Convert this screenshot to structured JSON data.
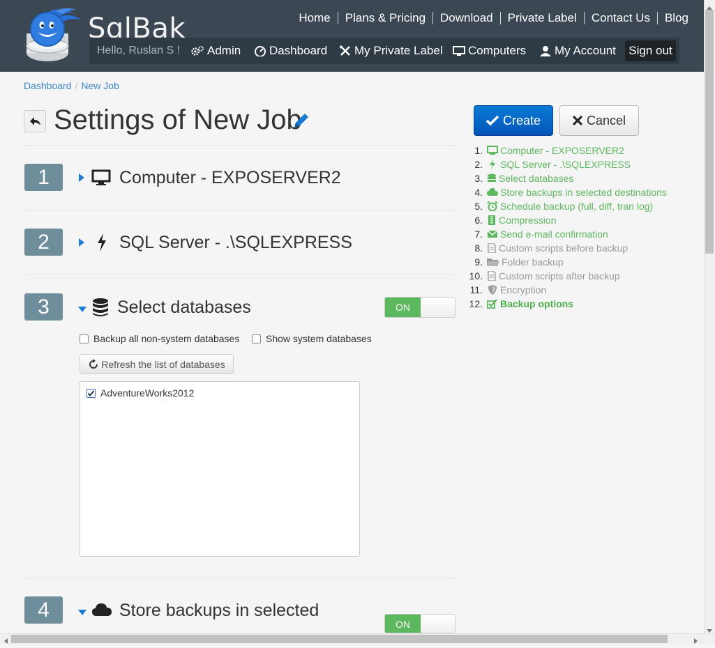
{
  "brand": {
    "logo_text": "SqlBak"
  },
  "top_nav": [
    "Home",
    "Plans & Pricing",
    "Download",
    "Private Label",
    "Contact Us",
    "Blog"
  ],
  "sub_nav": {
    "greeting": "Hello, Ruslan S !",
    "admin": "Admin",
    "dashboard": "Dashboard",
    "private_label": "My Private Label",
    "computers": "Computers",
    "account": "My Account",
    "signout": "Sign out"
  },
  "breadcrumb": {
    "dashboard": "Dashboard",
    "sep": "/",
    "current": "New Job"
  },
  "title": "Settings of New Job",
  "steps": [
    {
      "num": "1",
      "title": "Computer - EXPOSERVER2"
    },
    {
      "num": "2",
      "title": "SQL Server - .\\SQLEXPRESS"
    },
    {
      "num": "3",
      "title": "Select databases",
      "toggle": "ON"
    },
    {
      "num": "4",
      "title": "Store backups in selected",
      "toggle": "ON"
    }
  ],
  "select_db": {
    "backup_all_label": "Backup all non-system databases",
    "show_system_label": "Show system databases",
    "refresh_label": "Refresh the list of databases",
    "databases": [
      {
        "name": "AdventureWorks2012",
        "checked": true
      }
    ]
  },
  "actions": {
    "create": "Create",
    "cancel": "Cancel"
  },
  "step_list": [
    {
      "num": "1.",
      "label": "Computer - EXPOSERVER2",
      "icon": "monitor-icon",
      "state": "done"
    },
    {
      "num": "2.",
      "label": "SQL Server - .\\SQLEXPRESS",
      "icon": "bolt-icon",
      "state": "done"
    },
    {
      "num": "3.",
      "label": "Select databases",
      "icon": "database-icon",
      "state": "done"
    },
    {
      "num": "4.",
      "label": "Store backups in selected destinations",
      "icon": "cloud-icon",
      "state": "done"
    },
    {
      "num": "5.",
      "label": "Schedule backup (full, diff, tran log)",
      "icon": "alarm-clock-icon",
      "state": "done"
    },
    {
      "num": "6.",
      "label": "Compression",
      "icon": "compress-icon",
      "state": "done"
    },
    {
      "num": "7.",
      "label": "Send e-mail confirmation",
      "icon": "envelope-icon",
      "state": "done"
    },
    {
      "num": "8.",
      "label": "Custom scripts before backup",
      "icon": "file-icon",
      "state": "todo"
    },
    {
      "num": "9.",
      "label": "Folder backup",
      "icon": "folder-icon",
      "state": "todo"
    },
    {
      "num": "10.",
      "label": "Custom scripts after backup",
      "icon": "file-icon",
      "state": "todo"
    },
    {
      "num": "11.",
      "label": "Encryption",
      "icon": "shield-icon",
      "state": "todo"
    },
    {
      "num": "12.",
      "label": "Backup options",
      "icon": "check-square-icon",
      "state": "current"
    }
  ],
  "colors": {
    "header": "#3b4752",
    "accent_blue": "#0a6fcf",
    "success": "#5cb85c",
    "step_badge": "#6f8e9c"
  }
}
